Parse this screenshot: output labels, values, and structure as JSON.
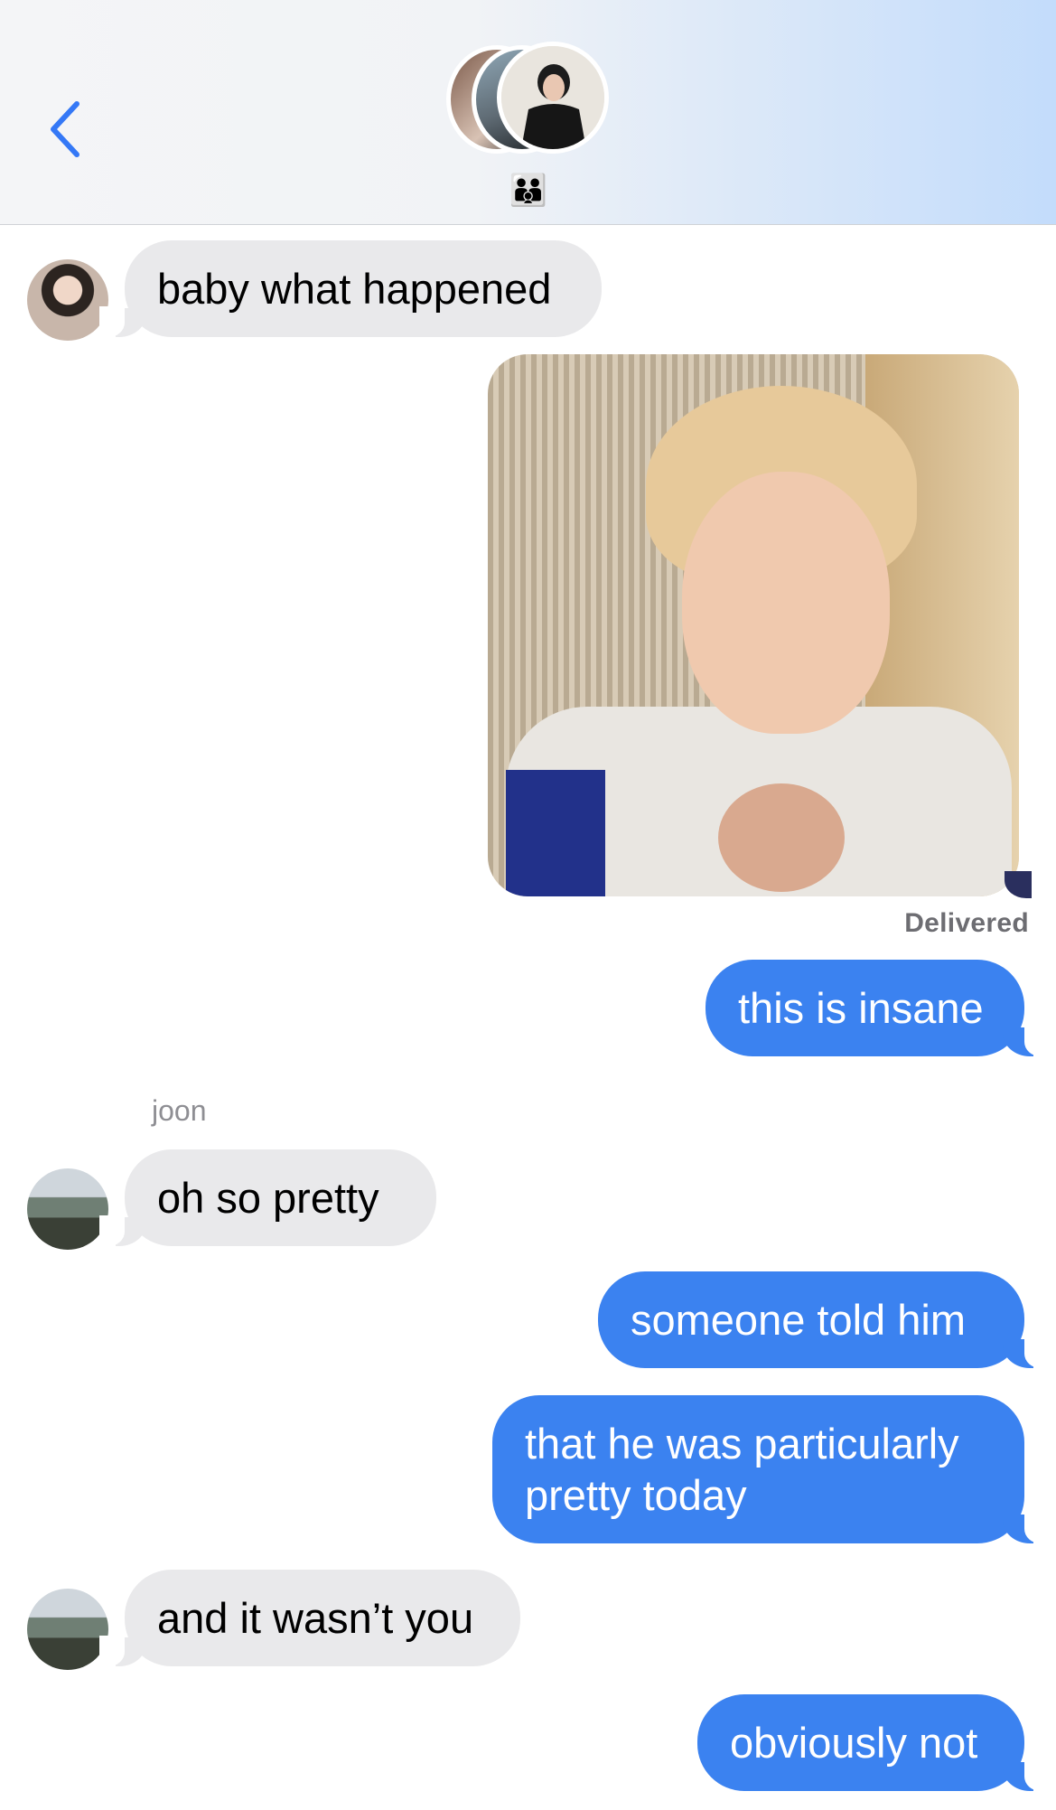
{
  "header": {
    "back_icon": "chevron-left-icon",
    "group_emoji": "👨‍👨‍👦",
    "accent_color": "#3478f6"
  },
  "messages": [
    {
      "direction": "incoming",
      "text": "baby what happened"
    },
    {
      "direction": "outgoing",
      "type": "image",
      "image": "photo"
    },
    {
      "status": "Delivered"
    },
    {
      "direction": "outgoing",
      "text": "this is insane"
    },
    {
      "sender": "joon"
    },
    {
      "direction": "incoming",
      "text": "oh so pretty"
    },
    {
      "direction": "outgoing",
      "text": "someone told him"
    },
    {
      "direction": "outgoing",
      "text": "that he was particularly pretty today"
    },
    {
      "direction": "incoming",
      "text": "and it wasn’t you"
    },
    {
      "direction": "outgoing",
      "text": "obviously not"
    }
  ],
  "colors": {
    "outgoing_bubble": "#3b82f0",
    "incoming_bubble": "#e9e9eb",
    "header_gradient_end": "#c3dcfb"
  }
}
